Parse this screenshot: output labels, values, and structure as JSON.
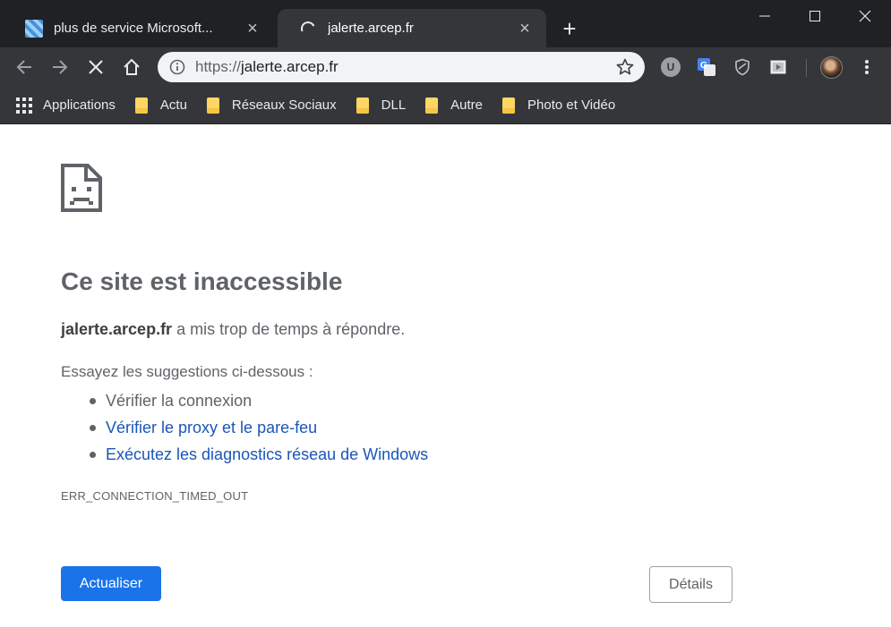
{
  "colors": {
    "titlebar_bg": "#202124",
    "toolbar_bg": "#35363a",
    "primary_button": "#1a73e8",
    "link": "#1a56b8",
    "text_secondary": "#5f6368"
  },
  "tabs": [
    {
      "title": "plus de service Microsoft...",
      "icon": "microsoft-favicon-icon",
      "state": "inactive"
    },
    {
      "title": "jalerte.arcep.fr",
      "icon": "loading-spinner-icon",
      "state": "active"
    }
  ],
  "toolbar": {
    "url_scheme": "https://",
    "url_host": "jalerte.arcep.fr",
    "icons": [
      "back-icon",
      "forward-icon",
      "stop-icon",
      "home-icon",
      "info-icon",
      "star-icon",
      "extension-u-icon",
      "translate-icon",
      "shield-icon",
      "video-icon",
      "avatar",
      "more-menu-icon"
    ],
    "extension_u_label": "U"
  },
  "bookmarks": [
    {
      "label": "Applications",
      "icon": "apps-grid-icon"
    },
    {
      "label": "Actu",
      "icon": "folder-icon"
    },
    {
      "label": "Réseaux Sociaux",
      "icon": "folder-icon"
    },
    {
      "label": "DLL",
      "icon": "folder-icon"
    },
    {
      "label": "Autre",
      "icon": "folder-icon"
    },
    {
      "label": "Photo et Vidéo",
      "icon": "folder-icon"
    }
  ],
  "error": {
    "icon": "sad-page-icon",
    "heading": "Ce site est inaccessible",
    "host": "jalerte.arcep.fr",
    "summary_rest": " a mis trop de temps à répondre.",
    "suggestions_title": "Essayez les suggestions ci-dessous :",
    "suggestions": [
      {
        "label": "Vérifier la connexion",
        "is_link": false
      },
      {
        "label": "Vérifier le proxy et le pare-feu",
        "is_link": true
      },
      {
        "label": "Exécutez les diagnostics réseau de Windows",
        "is_link": true
      }
    ],
    "code": "ERR_CONNECTION_TIMED_OUT",
    "reload_label": "Actualiser",
    "details_label": "Détails"
  }
}
